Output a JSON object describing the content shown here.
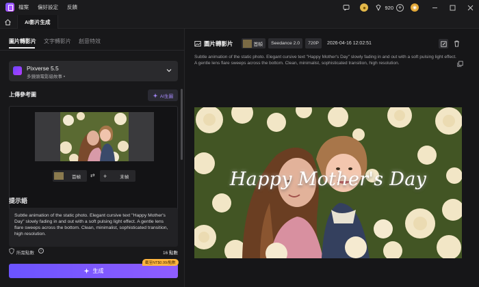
{
  "titlebar": {
    "menu": [
      "檔案",
      "偏好設定",
      "反饋"
    ],
    "credits": "920"
  },
  "tabbar": {
    "doc_tab": "AI影片生成"
  },
  "left": {
    "subtabs": [
      "圖片轉影片",
      "文字轉影片",
      "創意特效"
    ],
    "model": {
      "name": "Pixverse 5.5",
      "desc": "多鏡頭電影級故事 •"
    },
    "upload_title": "上傳參考圖",
    "ai_image_label": "AI生圖",
    "first_frame": "首幀",
    "last_frame": "末幀",
    "prompt_title": "提示語",
    "prompt_text": "Subtle animation of the static photo. Elegant cursive text \"Happy Mother's Day\" slowly fading in and out with a soft pulsing light effect. A gentle lens flare sweeps across the bottom. Clean, minimalist, sophisticated transition, high resolution.",
    "cost_label": "所需點數",
    "cost_value": "16 點數",
    "generate_label": "生成",
    "promo": "截至NT$0.99/點數"
  },
  "right": {
    "title": "圖片轉影片",
    "frame_chip": "首幀",
    "model_chip": "Seedance 2.0",
    "resolution_chip": "720P",
    "date": "2026-04-16 12:02:51",
    "description": "Subtle animation of the static photo. Elegant cursive text \"Happy Mother's Day\" slowly fading in and out with a soft pulsing light effect. A gentle lens flare sweeps across the bottom. Clean, minimalist, sophisticated transition, high resolution.",
    "video_caption": "Happy Mother's Day"
  },
  "colors": {
    "accent": "#7b5cff",
    "background": "#161618",
    "promo": "#ffb640"
  },
  "icons": [
    "app-logo-icon",
    "home-icon",
    "chevron-down-icon",
    "sparkle-icon",
    "plus-icon",
    "swap-icon",
    "info-icon",
    "shield-icon",
    "image-icon",
    "edit-icon",
    "trash-icon",
    "copy-icon",
    "coin-icon",
    "gem-icon",
    "minimize-icon",
    "maximize-icon",
    "close-icon"
  ]
}
